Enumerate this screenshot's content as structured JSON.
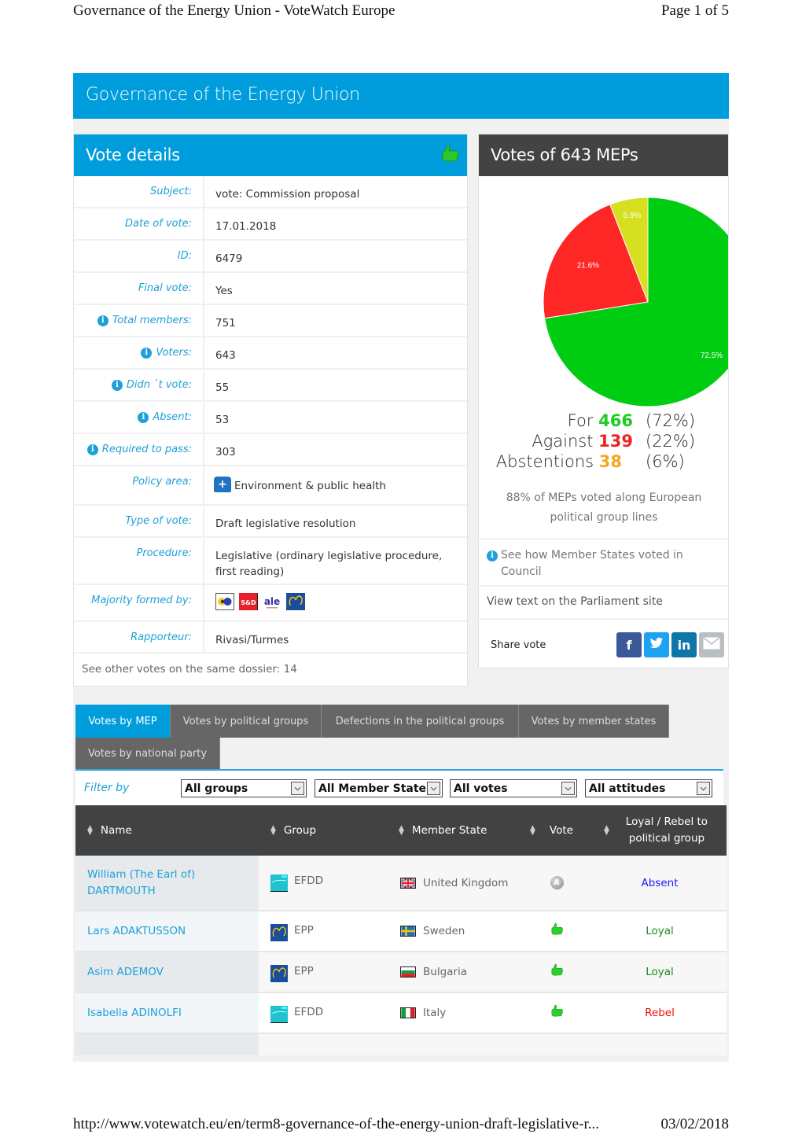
{
  "print_header": {
    "title": "Governance of the Energy Union - VoteWatch Europe",
    "page": "Page 1 of 5"
  },
  "print_footer": {
    "url": "http://www.votewatch.eu/en/term8-governance-of-the-energy-union-draft-legislative-r...",
    "date": "03/02/2018"
  },
  "page_title": "Governance of the Energy Union",
  "vote_details": {
    "heading": "Vote details",
    "rows": [
      {
        "label": "Subject:",
        "value": "vote: Commission proposal",
        "info": false
      },
      {
        "label": "Date of vote:",
        "value": "17.01.2018",
        "info": false
      },
      {
        "label": "ID:",
        "value": "6479",
        "info": false
      },
      {
        "label": "Final vote:",
        "value": "Yes",
        "info": false
      },
      {
        "label": "Total members:",
        "value": "751",
        "info": true
      },
      {
        "label": "Voters:",
        "value": "643",
        "info": true
      },
      {
        "label": "Didn `t vote:",
        "value": "55",
        "info": true
      },
      {
        "label": "Absent:",
        "value": "53",
        "info": true
      },
      {
        "label": "Required to pass:",
        "value": "303",
        "info": true
      },
      {
        "label": "Policy area:",
        "value": "Environment & public health",
        "info": false,
        "icon": "health-kit-icon"
      },
      {
        "label": "Type of vote:",
        "value": "Draft legislative resolution",
        "info": false
      },
      {
        "label": "Procedure:",
        "value": "Legislative (ordinary legislative procedure, first reading)",
        "info": false
      },
      {
        "label": "Majority formed by:",
        "value": "",
        "info": false,
        "groups": [
          "Greens/EFA",
          "S&D",
          "ALDE",
          "EPP"
        ]
      },
      {
        "label": "Rapporteur:",
        "value": "Rivasi/Turmes",
        "info": false
      }
    ],
    "footer": "See other votes on the same dossier: 14"
  },
  "votes_panel": {
    "heading": "Votes of 643 MEPs",
    "totals": [
      {
        "label": "For",
        "count": "466",
        "pct": "(72%)",
        "color": "#1fcc1f"
      },
      {
        "label": "Against",
        "count": "139",
        "pct": "(22%)",
        "color": "#ee2222"
      },
      {
        "label": "Abstentions",
        "count": "38",
        "pct": "(6%)",
        "color": "#f5a623"
      }
    ],
    "group_lines": "88% of MEPs voted along European political group lines",
    "council_link": "See how Member States voted in Council",
    "parliament_link": "View text on the Parliament site",
    "share_label": "Share vote",
    "share_buttons": [
      {
        "name": "facebook",
        "glyph": "f",
        "color": "#3b5998"
      },
      {
        "name": "twitter",
        "glyph": "t",
        "color": "#1da1f2"
      },
      {
        "name": "linkedin",
        "glyph": "in",
        "color": "#0e76a8"
      },
      {
        "name": "email",
        "glyph": "✉",
        "color": "#b8bec2"
      }
    ]
  },
  "chart_data": {
    "type": "pie",
    "title": "Votes of 643 MEPs",
    "slices": [
      {
        "label": "For",
        "value": 72.5,
        "display": "72.5%",
        "color": "#00cc11"
      },
      {
        "label": "Against",
        "value": 21.6,
        "display": "21.6%",
        "color": "#ff2626"
      },
      {
        "label": "Abstentions",
        "value": 5.9,
        "display": "5.9%",
        "color": "#d6e021"
      }
    ]
  },
  "tabs": [
    {
      "label": "Votes by MEP",
      "active": true
    },
    {
      "label": "Votes by political groups",
      "active": false
    },
    {
      "label": "Defections in the political groups",
      "active": false
    },
    {
      "label": "Votes by member states",
      "active": false
    },
    {
      "label": "Votes by national party",
      "active": false
    }
  ],
  "filters": {
    "label": "Filter by",
    "selects": [
      "All groups",
      "All Member State",
      "All votes",
      "All attitudes"
    ]
  },
  "table": {
    "columns": [
      "Name",
      "Group",
      "Member State",
      "Vote",
      "Loyal / Rebel to political group"
    ],
    "rows": [
      {
        "name": "William (The Earl of) DARTMOUTH",
        "group": "EFDD",
        "state": "United Kingdom",
        "vote": "absent",
        "attitude": "Absent",
        "attitude_color": "#1a1aff"
      },
      {
        "name": "Lars ADAKTUSSON",
        "group": "EPP",
        "state": "Sweden",
        "vote": "for",
        "attitude": "Loyal",
        "attitude_color": "#1a8a1a"
      },
      {
        "name": "Asim ADEMOV",
        "group": "EPP",
        "state": "Bulgaria",
        "vote": "for",
        "attitude": "Loyal",
        "attitude_color": "#1a8a1a"
      },
      {
        "name": "Isabella ADINOLFI",
        "group": "EFDD",
        "state": "Italy",
        "vote": "for",
        "attitude": "Rebel",
        "attitude_color": "#ee1111"
      }
    ]
  }
}
